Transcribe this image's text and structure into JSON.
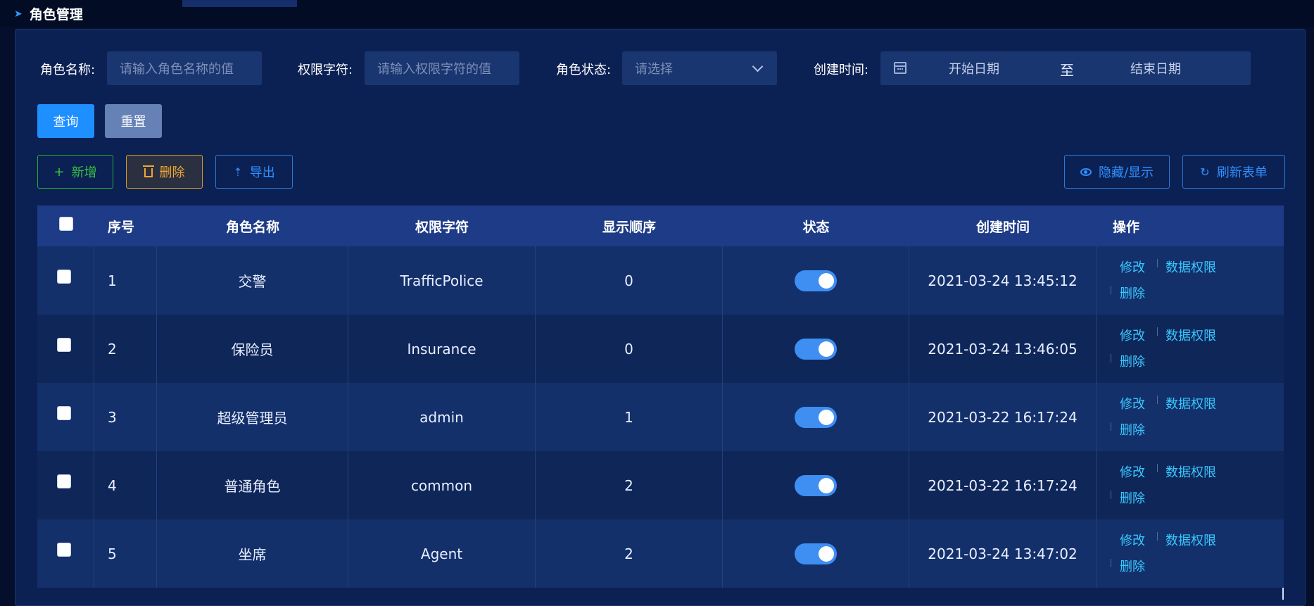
{
  "page": {
    "title": "角色管理"
  },
  "search": {
    "role_name_label": "角色名称:",
    "role_name_placeholder": "请输入角色名称的值",
    "perm_key_label": "权限字符:",
    "perm_key_placeholder": "请输入权限字符的值",
    "status_label": "角色状态:",
    "status_placeholder": "请选择",
    "created_label": "创建时间:",
    "start_date": "开始日期",
    "date_separator": "至",
    "end_date": "结束日期"
  },
  "actions": {
    "query": "查询",
    "reset": "重置",
    "add": "新增",
    "delete": "删除",
    "export": "导出",
    "toggle_columns": "隐藏/显示",
    "refresh": "刷新表单"
  },
  "table": {
    "headers": [
      "序号",
      "角色名称",
      "权限字符",
      "显示顺序",
      "状态",
      "创建时间",
      "操作"
    ],
    "rows": [
      {
        "idx": "1",
        "name": "交警",
        "key": "TrafficPolice",
        "sort": "0",
        "time": "2021-03-24 13:45:12"
      },
      {
        "idx": "2",
        "name": "保险员",
        "key": "Insurance",
        "sort": "0",
        "time": "2021-03-24 13:46:05"
      },
      {
        "idx": "3",
        "name": "超级管理员",
        "key": "admin",
        "sort": "1",
        "time": "2021-03-22 16:17:24"
      },
      {
        "idx": "4",
        "name": "普通角色",
        "key": "common",
        "sort": "2",
        "time": "2021-03-22 16:17:24"
      },
      {
        "idx": "5",
        "name": "坐席",
        "key": "Agent",
        "sort": "2",
        "time": "2021-03-24 13:47:02"
      }
    ],
    "ops": {
      "edit": "修改",
      "data_perm": "数据权限",
      "delete": "删除"
    }
  },
  "colors": {
    "accent": "#1e8fff",
    "link": "#39c8ff",
    "switch_on": "#3f8ef2"
  }
}
